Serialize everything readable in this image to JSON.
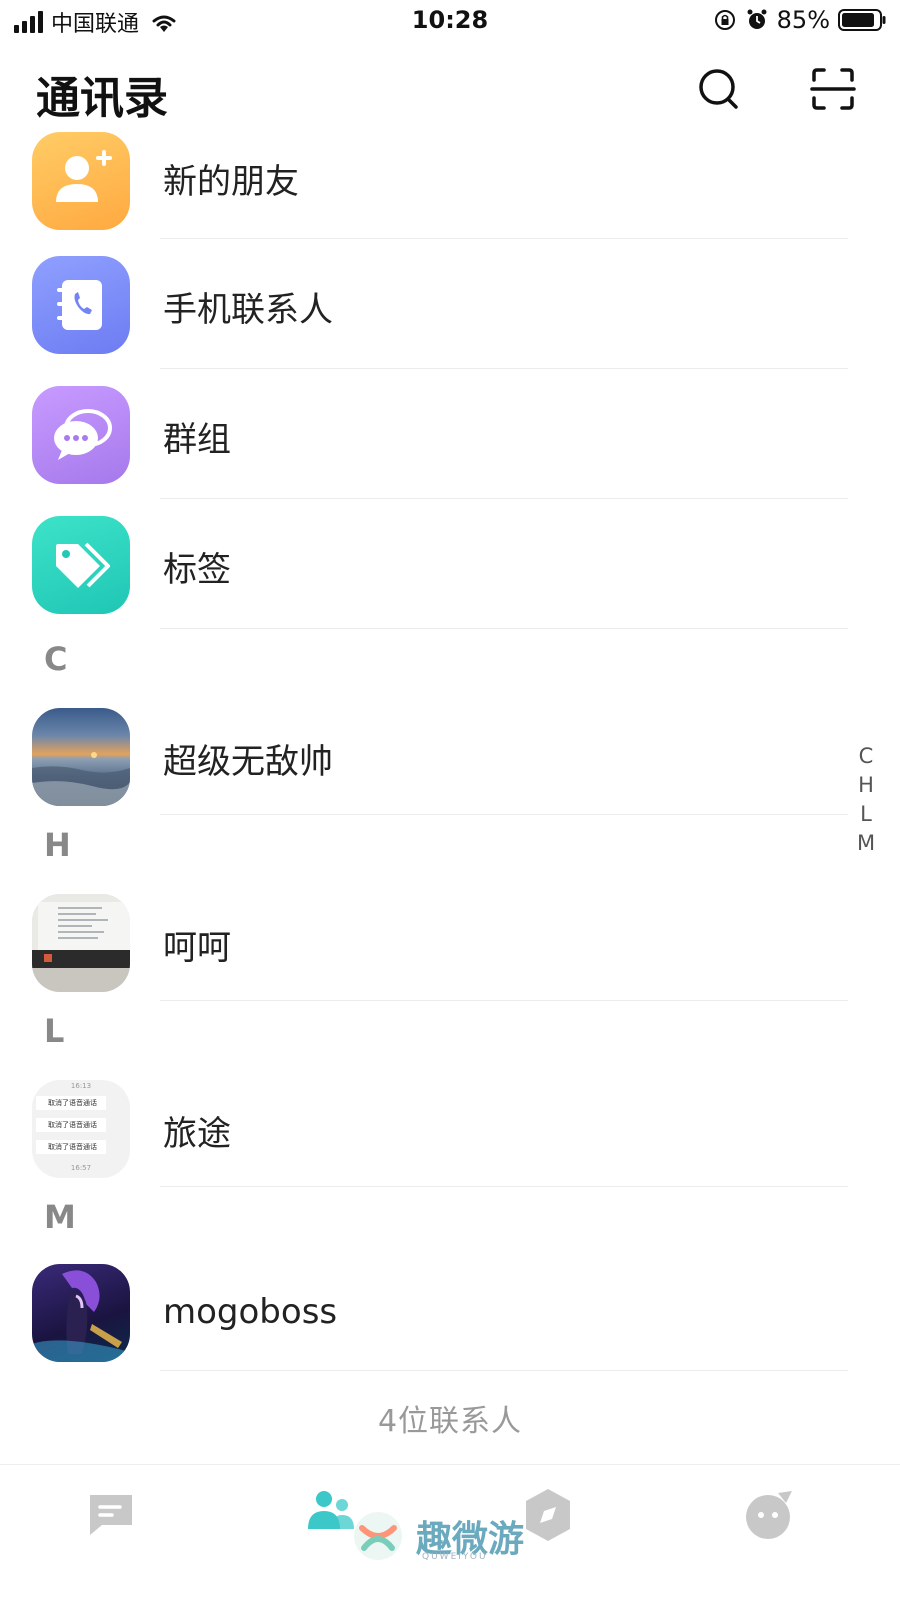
{
  "status_bar": {
    "carrier": "中国联通",
    "time": "10:28",
    "battery": "85%"
  },
  "header": {
    "title": "通讯录"
  },
  "menu_items": [
    {
      "label": "新的朋友",
      "icon": "add-friend-icon",
      "color": "#ffb84d"
    },
    {
      "label": "手机联系人",
      "icon": "phonebook-icon",
      "color": "#7f8df5"
    },
    {
      "label": "群组",
      "icon": "group-chat-icon",
      "color": "#b58af0"
    },
    {
      "label": "标签",
      "icon": "tag-icon",
      "color": "#2dd4bf"
    }
  ],
  "sections": [
    {
      "letter": "C",
      "contacts": [
        {
          "name": "超级无敌帅"
        }
      ]
    },
    {
      "letter": "H",
      "contacts": [
        {
          "name": "呵呵"
        }
      ]
    },
    {
      "letter": "L",
      "contacts": [
        {
          "name": "旅途",
          "avatar_lines": [
            "16:13",
            "取消了语音通话",
            "取消了语音通话",
            "取消了语音通话",
            "16:57"
          ]
        }
      ]
    },
    {
      "letter": "M",
      "contacts": [
        {
          "name": "mogoboss"
        }
      ]
    }
  ],
  "index_letters": [
    "C",
    "H",
    "L",
    "M"
  ],
  "contact_count": "4位联系人",
  "tab_bar": {
    "tabs": [
      "messages-icon",
      "contacts-icon",
      "discover-icon",
      "me-icon"
    ],
    "active_color": "#3cc8c8",
    "inactive_color": "#c8c8c8"
  },
  "watermark": {
    "text": "趣微游",
    "sub": "QUWEIYOU"
  }
}
